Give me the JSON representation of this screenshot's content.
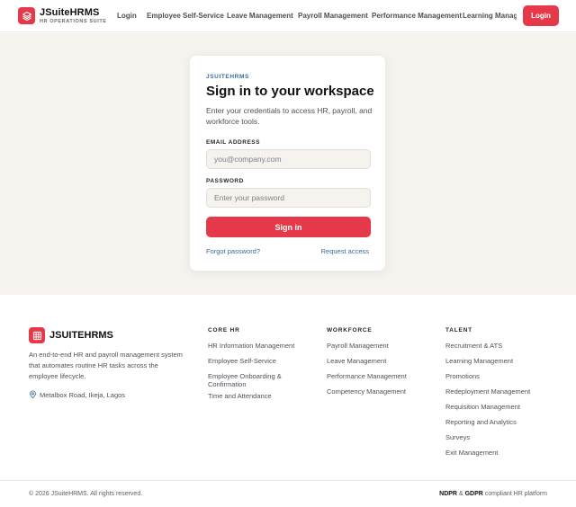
{
  "brand": {
    "name": "JSuiteHRMS",
    "tagline": "HR OPERATIONS SUITE",
    "accent_color": "#e5394a",
    "logo_icon": "layers-icon"
  },
  "nav": {
    "items": [
      "Login",
      "Employee Self-Service",
      "Leave Management",
      "Payroll Management",
      "Performance Management",
      "Learning Management"
    ],
    "login_button": "Login"
  },
  "login_card": {
    "eyebrow": "JSUITEHRMS",
    "title": "Sign in to your workspace",
    "description": "Enter your credentials to access HR, payroll, and workforce tools.",
    "email_label": "EMAIL ADDRESS",
    "email_value": "",
    "email_placeholder": "you@company.com",
    "password_label": "PASSWORD",
    "password_value": "",
    "password_placeholder": "Enter your password",
    "submit_label": "Sign in",
    "forgot_link": "Forgot password?",
    "request_link": "Request access"
  },
  "footer": {
    "brand": "JSUITEHRMS",
    "logo_icon": "grid-icon",
    "description": "An end-to-end HR and payroll management system that automates routine HR tasks across the employee lifecycle.",
    "location_icon": "map-pin-icon",
    "location": "Metalbox Road, Ikeja, Lagos",
    "columns": [
      {
        "title": "CORE HR",
        "links": [
          "HR Information Management",
          "Employee Self-Service",
          "Employee Onboarding & Confirmation",
          "Time and Attendance"
        ]
      },
      {
        "title": "WORKFORCE",
        "links": [
          "Payroll Management",
          "Leave Management",
          "Performance Management",
          "Competency Management"
        ]
      },
      {
        "title": "TALENT",
        "links": [
          "Recruitment & ATS",
          "Learning Management",
          "Promotions",
          "Redeployment Management",
          "Requisition Management",
          "Reporting and Analytics",
          "Surveys",
          "Exit Management"
        ]
      }
    ],
    "copyright": "© 2026 JSuiteHRMS. All rights reserved.",
    "compliance": {
      "ndpr": "NDPR",
      "amp": "&",
      "gdpr": "GDPR",
      "suffix": "compliant HR platform"
    }
  }
}
